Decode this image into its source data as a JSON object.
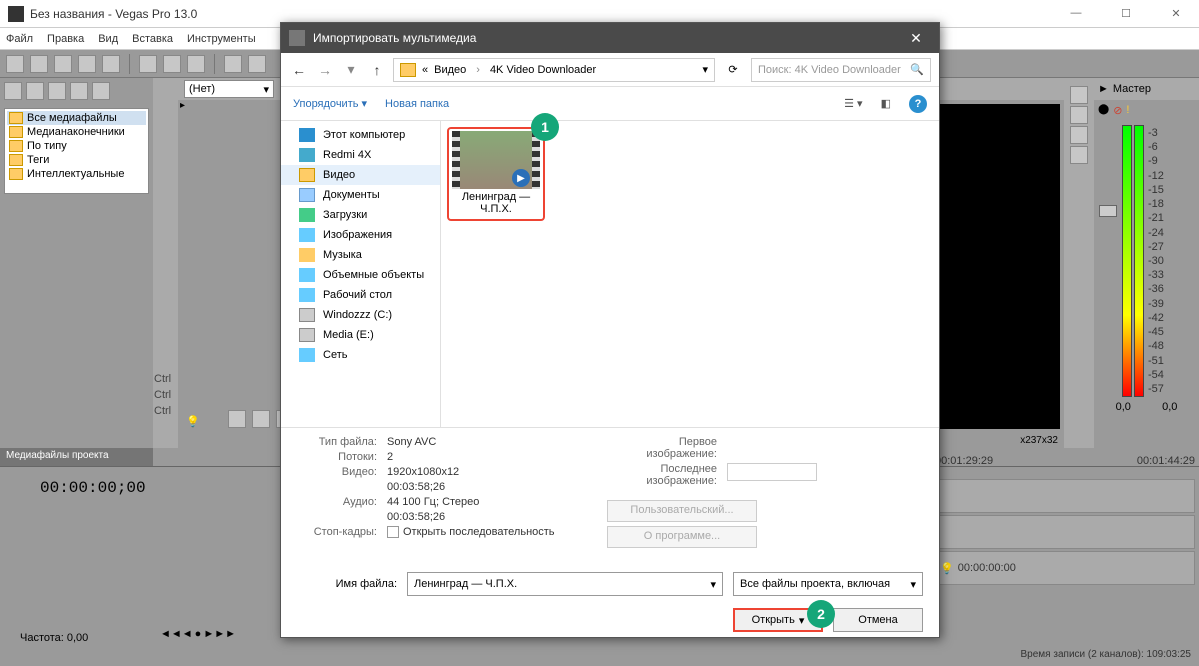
{
  "vegas": {
    "title": "Без названия - Vegas Pro 13.0",
    "menu": [
      "Файл",
      "Правка",
      "Вид",
      "Вставка",
      "Инструменты"
    ],
    "tree": {
      "root": "Все медиафайлы",
      "items": [
        "Медианаконечники",
        "По типу",
        "Теги",
        "Интеллектуальные"
      ]
    },
    "resolver": [
      "Ctrl",
      "Ctrl",
      "Ctrl"
    ],
    "center_combo": "(Нет)",
    "status_mediafiles": "Медиафайлы проекта",
    "master_label": "Мастер",
    "master_readouts": [
      "0,0",
      "0,0"
    ],
    "preview_status": "x237x32",
    "timecode": "00:00:00;00",
    "frequency": "Частота: 0,00",
    "timeline": {
      "marks": [
        "00:01:29:29",
        "00:01:44:29"
      ],
      "rec_info": "Время записи (2 каналов): 109:03:25",
      "time_small": "00:00:00:00"
    },
    "meter_ticks": [
      "-3",
      "-6",
      "-9",
      "-12",
      "-15",
      "-18",
      "-21",
      "-24",
      "-27",
      "-30",
      "-33",
      "-36",
      "-39",
      "-42",
      "-45",
      "-48",
      "-51",
      "-54",
      "-57"
    ]
  },
  "dialog": {
    "title": "Импортировать мультимедиа",
    "breadcrumb": [
      "Видео",
      "4K Video Downloader"
    ],
    "search_placeholder": "Поиск: 4K Video Downloader",
    "toolbar": {
      "organize": "Упорядочить",
      "newfolder": "Новая папка"
    },
    "sidebar": [
      {
        "label": "Этот компьютер",
        "icon": "icon-pc"
      },
      {
        "label": "Redmi 4X",
        "icon": "icon-phone"
      },
      {
        "label": "Видео",
        "icon": "icon-folder",
        "active": true
      },
      {
        "label": "Документы",
        "icon": "icon-doc"
      },
      {
        "label": "Загрузки",
        "icon": "icon-dl"
      },
      {
        "label": "Изображения",
        "icon": "icon-img"
      },
      {
        "label": "Музыка",
        "icon": "icon-music"
      },
      {
        "label": "Объемные объекты",
        "icon": "icon-3d"
      },
      {
        "label": "Рабочий стол",
        "icon": "icon-desk"
      },
      {
        "label": "Windozzz (C:)",
        "icon": "icon-drive"
      },
      {
        "label": "Media (E:)",
        "icon": "icon-drive"
      },
      {
        "label": "Сеть",
        "icon": "icon-net"
      }
    ],
    "file": {
      "name": "Ленинград — Ч.П.Х."
    },
    "meta": {
      "filetype_label": "Тип файла:",
      "filetype": "Sony AVC",
      "streams_label": "Потоки:",
      "streams": "2",
      "video_label": "Видео:",
      "video": "1920x1080x12",
      "video_dur": "00:03:58;26",
      "audio_label": "Аудио:",
      "audio": "44 100 Гц; Стерео",
      "audio_dur": "00:03:58;26",
      "still_label": "Стоп-кадры:",
      "still": "Открыть последовательность",
      "first_label": "Первое изображение:",
      "last_label": "Последнее изображение:",
      "custom_btn": "Пользовательский...",
      "about_btn": "О программе..."
    },
    "filename_label": "Имя файла:",
    "filename_value": "Ленинград — Ч.П.Х.",
    "filter": "Все файлы проекта, включая",
    "open": "Открыть",
    "cancel": "Отмена"
  },
  "annotations": {
    "n1": "1",
    "n2": "2"
  }
}
